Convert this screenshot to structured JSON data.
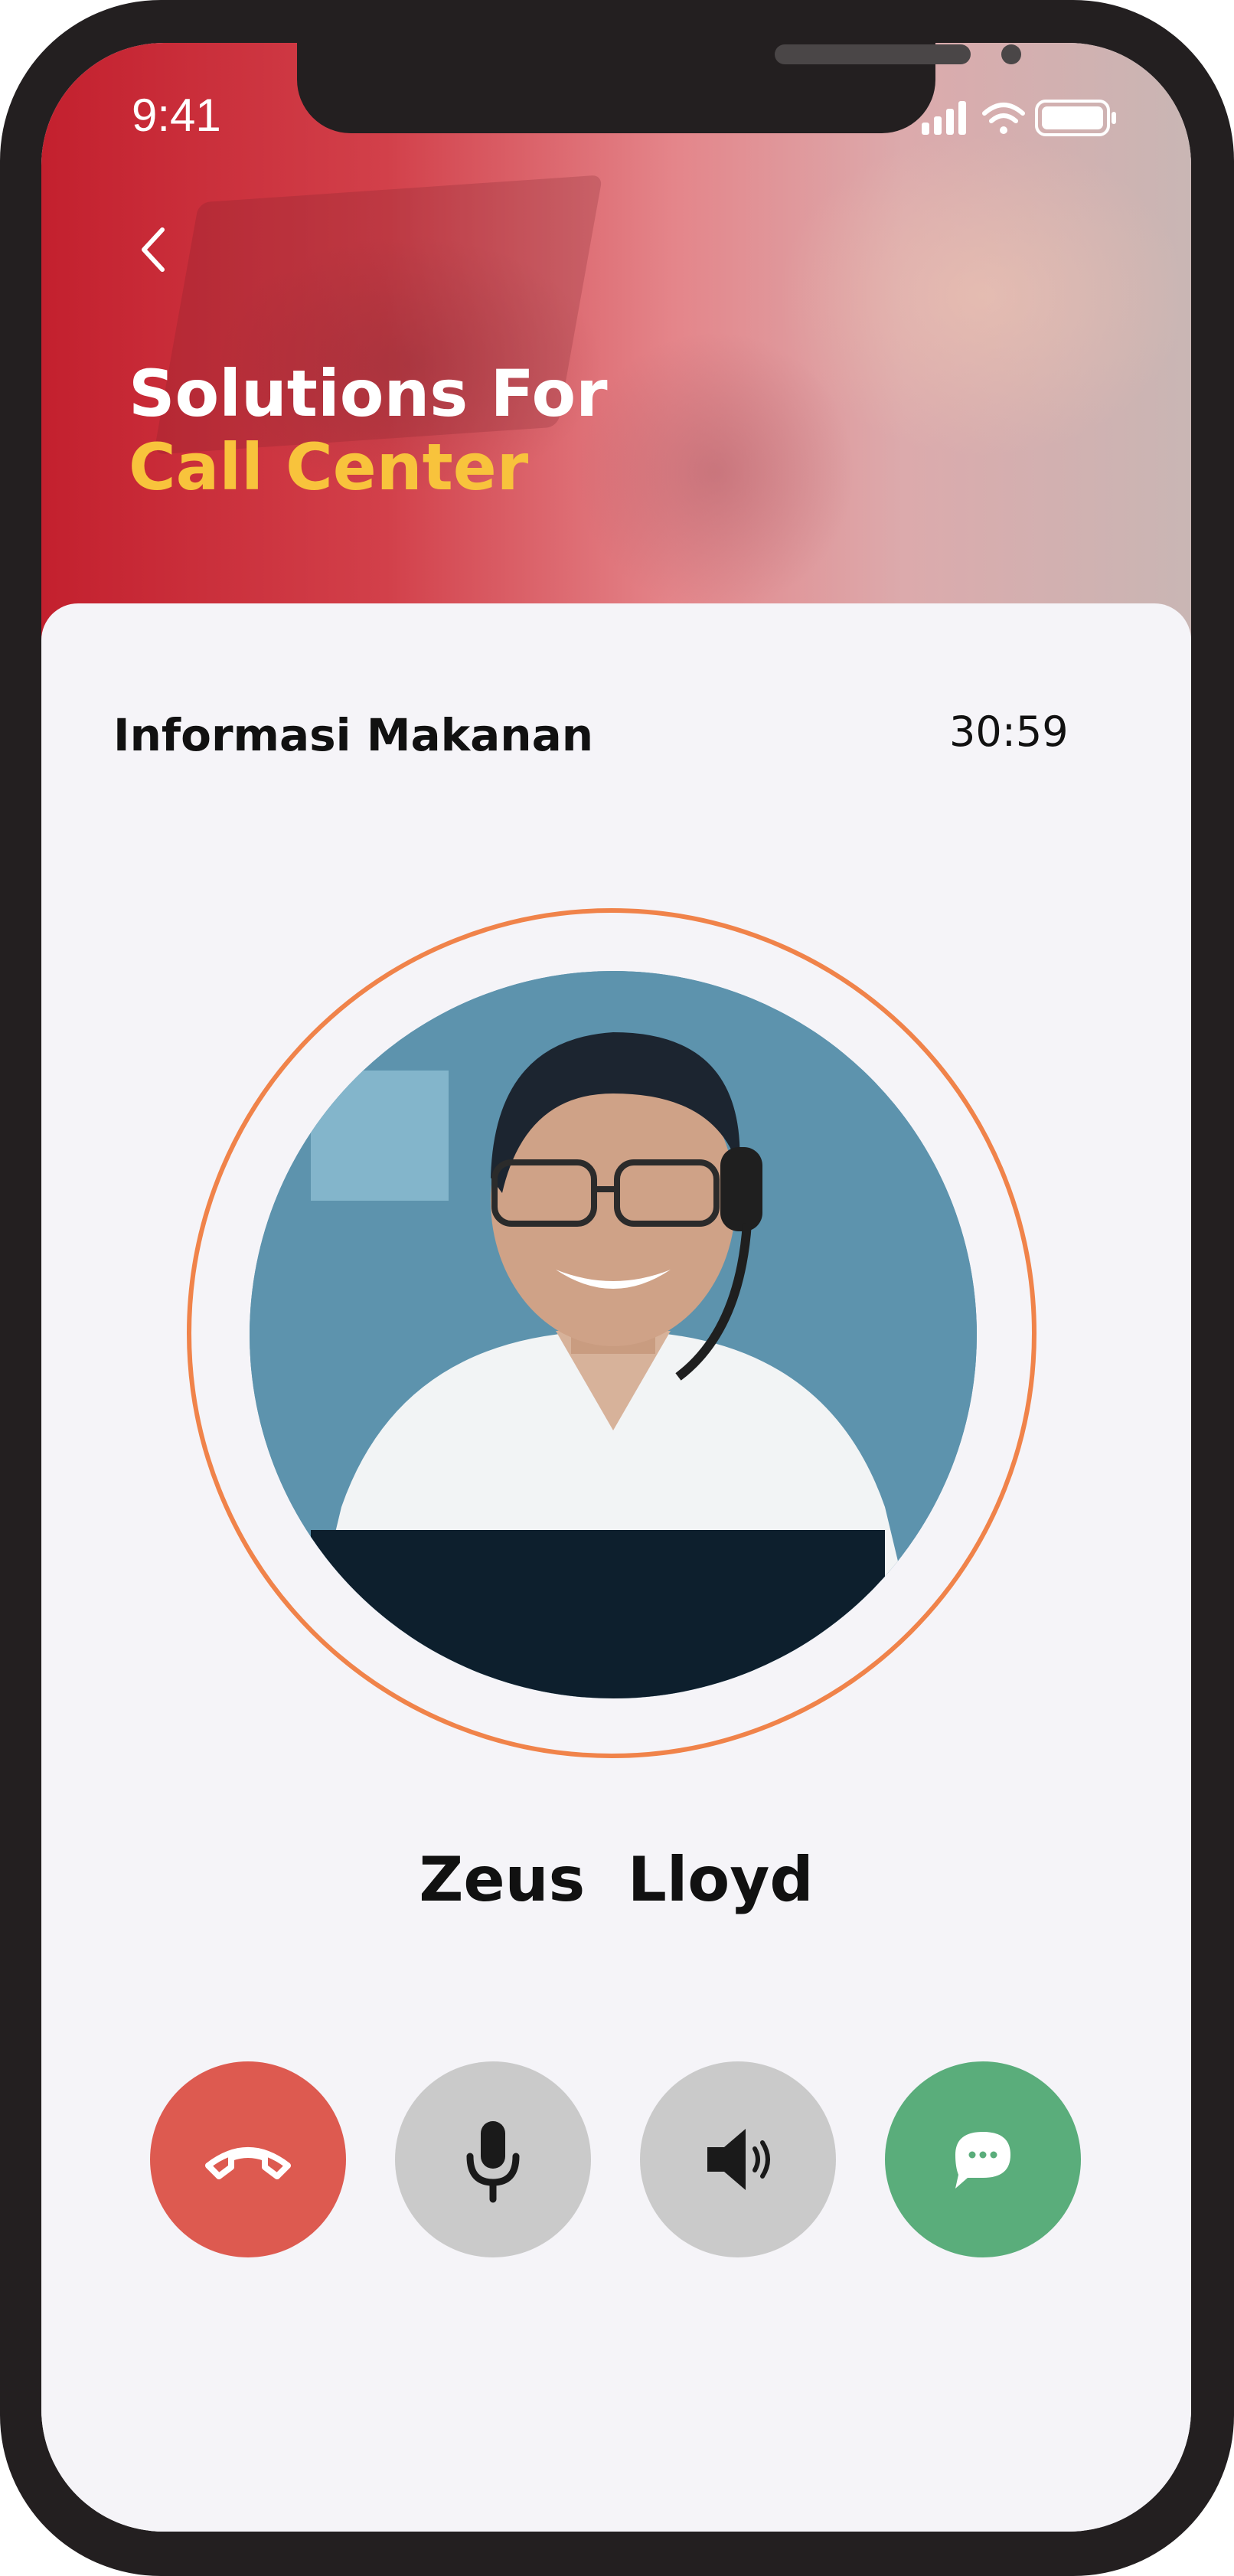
{
  "status_bar": {
    "time": "9:41"
  },
  "header": {
    "title_line1": "Solutions For",
    "title_line2": "Call Center",
    "back_icon": "chevron-left-icon"
  },
  "call": {
    "topic": "Informasi Makanan",
    "duration": "30:59",
    "caller_name": "Zeus  Lloyd"
  },
  "controls": [
    {
      "name": "end-call",
      "icon": "phone-hangup-icon",
      "color": "#dd5a50"
    },
    {
      "name": "mute",
      "icon": "microphone-icon",
      "color": "#cacaca"
    },
    {
      "name": "speaker",
      "icon": "speaker-icon",
      "color": "#cacaca"
    },
    {
      "name": "chat",
      "icon": "chat-bubble-icon",
      "color": "#5aad7b"
    }
  ],
  "colors": {
    "accent": "#f8c33c",
    "ring": "#f0834a",
    "brand_red": "#c3202e"
  }
}
